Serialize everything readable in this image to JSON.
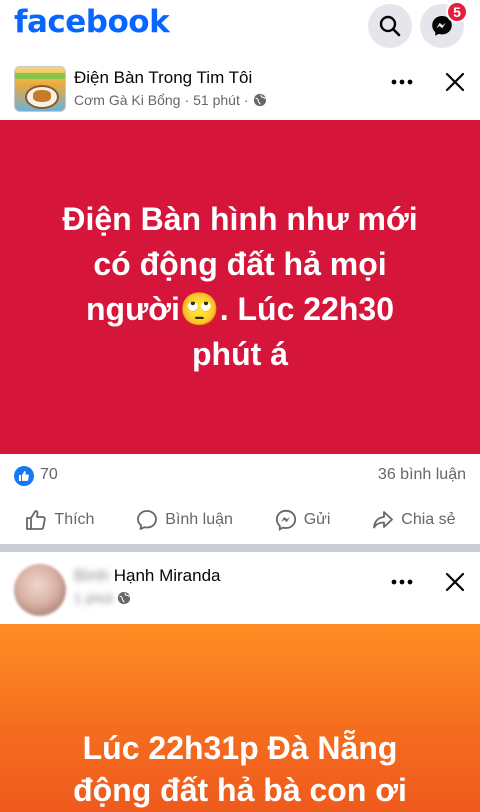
{
  "header": {
    "logo_text": "facebook",
    "notification_count": "5",
    "brand_color": "#0866ff",
    "badge_color": "#e41e3f"
  },
  "post1": {
    "title": "Điện Bàn Trong Tim Tôi",
    "author": "Cơm Gà Ki Bổng",
    "time": "51 phút",
    "separator": "·",
    "text_lines": [
      "Điện Bàn hình như mới",
      "có động đất hả mọi",
      "người🙄. Lúc 22h30",
      "phút á"
    ],
    "background_color": "#d6153b",
    "like_count": "70",
    "comment_count": "36 bình luận",
    "actions": {
      "like": "Thích",
      "comment": "Bình luận",
      "send": "Gửi",
      "share": "Chia sẻ"
    }
  },
  "post2": {
    "title_hidden": "Bình",
    "title": "Hạnh Miranda",
    "meta_hidden": "1 phút",
    "text_lines": [
      "Lúc 22h31p Đà Nẵng",
      "động đất hả bà con ơi"
    ]
  }
}
